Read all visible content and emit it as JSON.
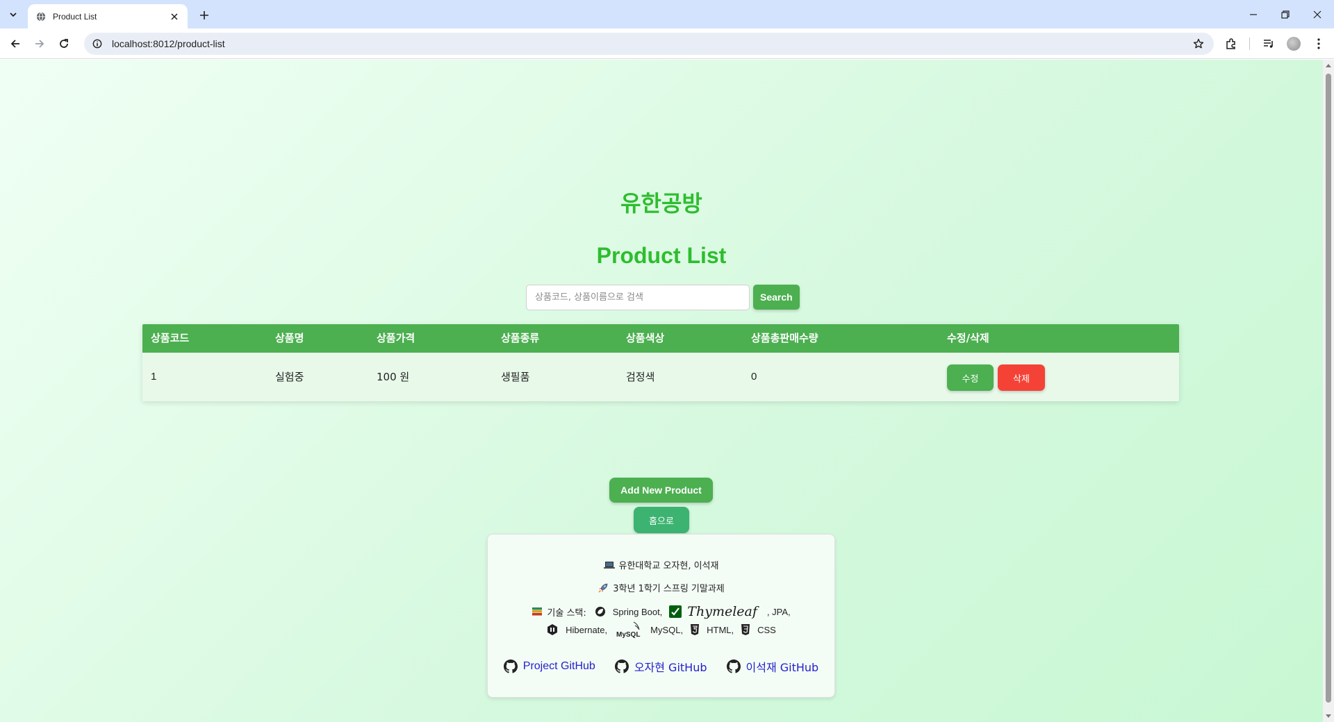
{
  "browser": {
    "tab_title": "Product List",
    "url": "localhost:8012/product-list"
  },
  "page": {
    "shop_name": "유한공방",
    "title": "Product List",
    "search": {
      "placeholder": "상품코드, 상품이름으로 검색",
      "button_label": "Search"
    },
    "table": {
      "headers": [
        "상품코드",
        "상품명",
        "상품가격",
        "상품종류",
        "상품색상",
        "상품총판매수량",
        "수정/삭제"
      ],
      "rows": [
        {
          "code": "1",
          "name": "실험중",
          "price": "100 원",
          "type": "생필품",
          "color": "검정색",
          "sold": "0",
          "edit_label": "수정",
          "delete_label": "삭제"
        }
      ]
    },
    "add_button": "Add New Product",
    "home_button": "홈으로",
    "footer": {
      "authors": "유한대학교 오자현, 이석재",
      "project": "3학년 1학기 스프링 기말과제",
      "stack_label": "기술 스택:",
      "stack": [
        "Spring Boot,",
        "Thymeleaf",
        ", JPA,",
        "Hibernate,",
        "MySQL,",
        "HTML,",
        "CSS"
      ],
      "mysql_logo_text": "MySQL",
      "links": [
        "Project GitHub",
        "오자현 GitHub",
        "이석재 GitHub"
      ]
    }
  },
  "colors": {
    "accent_green": "#4caf50",
    "title_green": "#2ebd2e",
    "danger_red": "#f44336",
    "link_blue": "#2222cc"
  },
  "icons": [
    "chevron-down-icon",
    "globe-icon",
    "close-icon",
    "plus-icon",
    "minimize-icon",
    "restore-icon",
    "back-icon",
    "forward-icon",
    "reload-icon",
    "info-icon",
    "star-icon",
    "extensions-icon",
    "media-icon",
    "profile-avatar",
    "menu-icon",
    "laptop-icon",
    "rocket-icon",
    "books-icon",
    "spring-icon",
    "thymeleaf-icon",
    "hibernate-icon",
    "mysql-icon",
    "html5-icon",
    "css3-icon",
    "github-icon"
  ]
}
